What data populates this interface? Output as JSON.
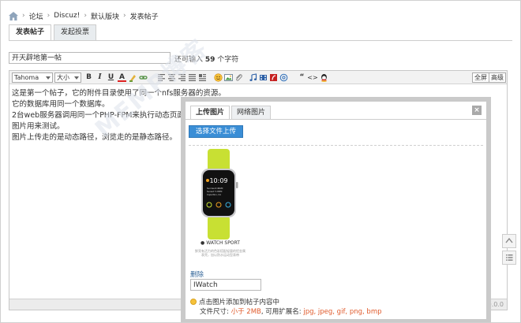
{
  "breadcrumb": {
    "items": [
      "论坛",
      "Discuz!",
      "默认版块",
      "发表帖子"
    ]
  },
  "tabs": [
    "发表帖子",
    "发起投票"
  ],
  "subject": {
    "value": "开天辟地第一帖",
    "hint_prefix": "还可输入",
    "hint_count": "59",
    "hint_suffix": "个字符"
  },
  "toolbar": {
    "font_family": "Tahoma",
    "font_size": "大小",
    "bold": "B",
    "italic": "I",
    "underline": "U",
    "font_color": "A",
    "quote": "“",
    "code": "<>",
    "fullscreen": "全屏",
    "advanced": "高级"
  },
  "content": {
    "lines": [
      "这是第一个帖子，它的附件目录使用了同一个nfs服务器的资源。",
      "它的数据库用同一个数据库。",
      "2台web服务器调用同一个PHP-FPM来执行动态页面。",
      "图片用来测试。",
      "图片上传走的是动态路径，浏览走的是静态路径。"
    ]
  },
  "statusbar": {
    "right_text": "0.0.0"
  },
  "watermark": "MEMP博客",
  "dialog": {
    "tabs": [
      "上传图片",
      "网络图片"
    ],
    "close": "×",
    "upload_button": "选择文件上传",
    "watch_caption": "WATCH SPORT",
    "watch_desc": "鲜亮有活力的色彩搭配轻量的铝金属表壳，加以防水运动型表带",
    "watch_time": "10:09",
    "delete": "删除",
    "image_title": "IWatch",
    "tip_line1": "点击图片添加到帖子内容中",
    "tip_size_label": "文件尺寸:",
    "tip_size_value": "小于 2MB",
    "tip_ext_label": ", 可用扩展名:",
    "tip_ext_value": "jpg, jpeg, gif, png, bmp"
  },
  "colors": {
    "accent": "#3a8ed6",
    "link": "#336699",
    "warning": "#e05a2b",
    "watch_band": "#c8e033"
  }
}
